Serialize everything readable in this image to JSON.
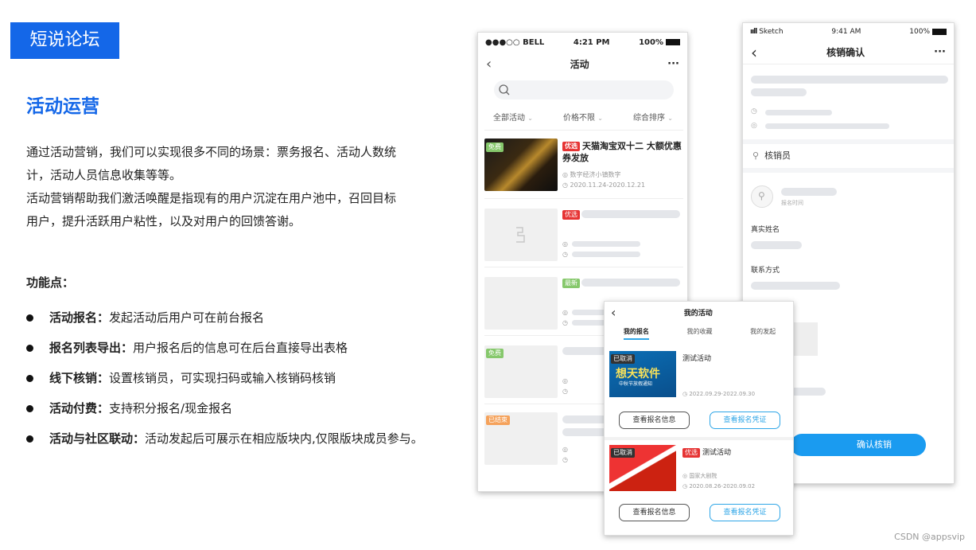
{
  "slide": {
    "tag": "短说论坛",
    "heading": "活动运营",
    "intro": [
      "通过活动营销，我们可以实现很多不同的场景：票务报名、活动人数统",
      "计，活动人员信息收集等等。",
      "活动营销帮助我们激活唤醒是指现有的用户沉淀在用户池中，召回目标",
      "用户，提升活跃用户粘性，以及对用户的回馈答谢。"
    ],
    "features_heading": "功能点：",
    "features": [
      {
        "name": "活动报名：",
        "desc": "发起活动后用户可在前台报名"
      },
      {
        "name": "报名列表导出：",
        "desc": "用户报名后的信息可在后台直接导出表格"
      },
      {
        "name": "线下核销：",
        "desc": "设置核销员，可实现扫码或输入核销码核销"
      },
      {
        "name": "活动付费：",
        "desc": "支持积分报名/现金报名"
      },
      {
        "name": "活动与社区联动：",
        "desc": "活动发起后可展示在相应版块内,仅限版块成员参与。"
      }
    ],
    "watermark": "CSDN @appsvip"
  },
  "phone1": {
    "carrier": "●●●○○ BELL",
    "time": "4:21 PM",
    "battery": "100%",
    "title": "活动",
    "more": "···",
    "filters": [
      "全部活动",
      "价格不限",
      "综合排序"
    ],
    "first_card": {
      "badge": "优选",
      "free_badge": "免费",
      "title": "天猫淘宝双十二 大额优惠券发放",
      "location": "数字经济小镇数字",
      "dates": "2020.11.24-2020.12.21"
    },
    "card_badges": [
      "优选",
      "最新",
      "免费",
      "已结束"
    ]
  },
  "phone2": {
    "carrier": "Sketch",
    "time": "9:41 AM",
    "battery": "100%",
    "title": "核销确认",
    "more": "···",
    "verifier_label": "核销员",
    "signup_time_label": "报名时间",
    "real_name_label": "真实姓名",
    "contact_label": "联系方式",
    "confirm_button": "确认核销"
  },
  "phone3": {
    "title": "我的活动",
    "tabs": [
      "我的报名",
      "我的收藏",
      "我的发起"
    ],
    "items": [
      {
        "status": "已取消",
        "banner_title": "想天软件",
        "banner_sub": "中秋节放假通知",
        "badge": "",
        "title": "测试活动",
        "location": "",
        "dates": "2022.09.29-2022.09.30",
        "btn_info": "查看报名信息",
        "btn_voucher": "查看报名凭证"
      },
      {
        "status": "已取消",
        "banner_title": "",
        "banner_sub": "",
        "badge": "优选",
        "title": "测试活动",
        "location": "国家大剧院",
        "dates": "2020.08.26-2020.09.02",
        "btn_info": "查看报名信息",
        "btn_voucher": "查看报名凭证"
      }
    ]
  }
}
